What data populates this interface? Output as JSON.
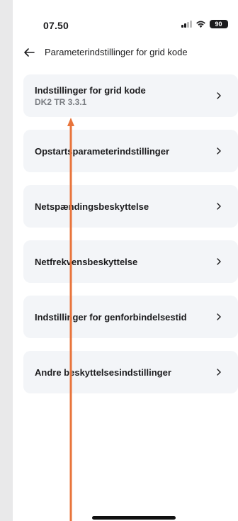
{
  "status_bar": {
    "time": "07.50",
    "battery": "90"
  },
  "header": {
    "title": "Parameterindstillinger for grid kode",
    "back_icon": "arrow-left-icon"
  },
  "items": [
    {
      "title": "Indstillinger for grid kode",
      "subtitle": "DK2 TR 3.3.1"
    },
    {
      "title": "Opstartsparameterindstillinger"
    },
    {
      "title": "Netspændingsbeskyttelse"
    },
    {
      "title": "Netfrekvensbeskyttelse"
    },
    {
      "title": "Indstillinger for genforbindelsestid"
    },
    {
      "title": "Andre beskyttelsesindstillinger"
    }
  ],
  "colors": {
    "annotation_arrow": "#e8743b",
    "card_bg": "#f3f5f8"
  }
}
